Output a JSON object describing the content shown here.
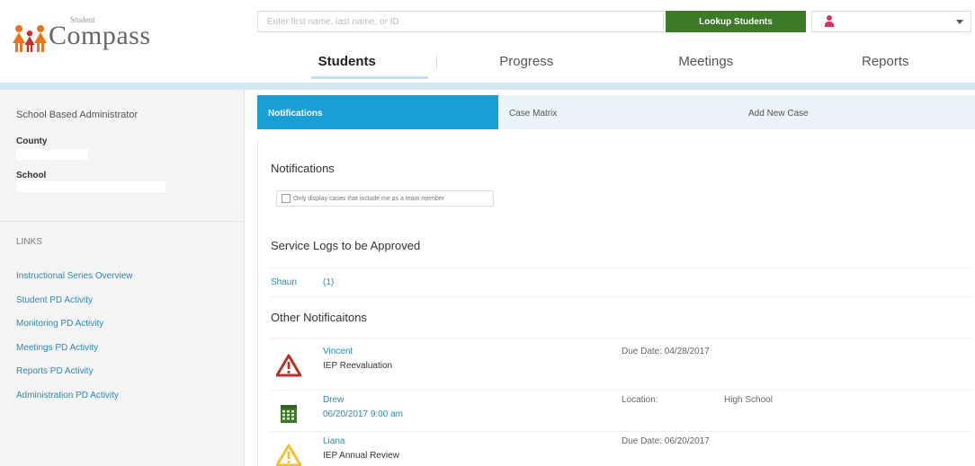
{
  "app": {
    "logo_sub": "Student",
    "logo_main": "Compass"
  },
  "header": {
    "search_placeholder": "Enter first name, last name, or ID",
    "lookup_label": "Lookup Students"
  },
  "nav": {
    "tabs": [
      {
        "label": "Students",
        "active": true
      },
      {
        "label": "Progress"
      },
      {
        "label": "Meetings"
      },
      {
        "label": "Reports"
      }
    ]
  },
  "sidebar": {
    "role": "School Based Administrator",
    "county_label": "County",
    "school_label": "School",
    "links_title": "LINKS",
    "links": [
      "Instructional Series Overview",
      "Student PD Activity",
      "Monitoring PD Activity",
      "Meetings PD Activity",
      "Reports PD Activity",
      "Administration PD Activity"
    ]
  },
  "subtabs": [
    {
      "label": "Notifications",
      "active": true
    },
    {
      "label": "Case Matrix"
    },
    {
      "label": "Add New Case"
    }
  ],
  "main": {
    "notifications_title": "Notifications",
    "checkbox_label": "Only display cases that include me as a team member",
    "service_logs_title": "Service Logs to be Approved",
    "service_log": {
      "name": "Shaun",
      "count": "(1)"
    },
    "other_title": "Other Notificaitons",
    "items": [
      {
        "icon": "warning-red-icon",
        "name": "Vincent",
        "sub": "IEP Reevaluation",
        "detail_label": "Due Date: 04/28/2017",
        "detail_value": ""
      },
      {
        "icon": "calendar-icon",
        "name": "Drew",
        "sub": "06/20/2017 9:00 am",
        "detail_label": "Location:",
        "detail_value": "High School"
      },
      {
        "icon": "warning-yellow-icon",
        "name": "Liana",
        "sub": "IEP Annual Review",
        "detail_label": "Due Date: 06/20/2017",
        "detail_value": ""
      }
    ]
  },
  "colors": {
    "accent": "#1a9ed6",
    "lookup": "#3d7a28",
    "link": "#2a8bb0",
    "band": "#d3e8f0"
  }
}
